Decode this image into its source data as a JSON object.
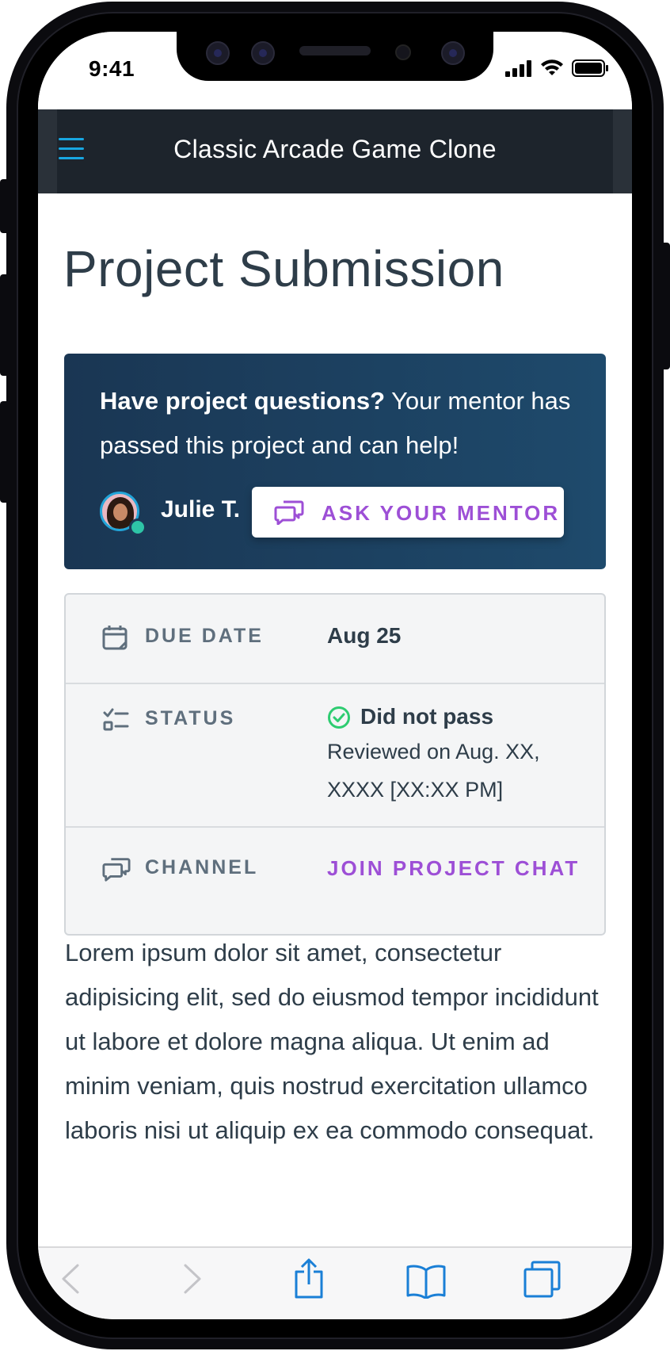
{
  "status_bar": {
    "time": "9:41"
  },
  "nav": {
    "title": "Classic Arcade Game Clone"
  },
  "page": {
    "title": "Project Submission"
  },
  "mentor_card": {
    "question_bold": "Have project questions?",
    "question_rest": " Your mentor has passed this project and can help!",
    "mentor_name": "Julie T.",
    "ask_button": "ASK YOUR MENTOR"
  },
  "info": {
    "due_date_label": "DUE DATE",
    "due_date_value": "Aug 25",
    "status_label": "STATUS",
    "status_value": "Did not pass",
    "reviewed_text": "Reviewed on Aug. XX, XXXX [XX:XX PM]",
    "channel_label": "CHANNEL",
    "channel_link": "JOIN PROJECT CHAT"
  },
  "body": {
    "text": "Lorem ipsum dolor sit amet, consectetur adipisicing elit, sed do eiusmod tempor incididunt ut labore et dolore magna aliqua. Ut enim ad minim veniam, quis nostrud exercitation ullamco laboris nisi ut aliquip ex ea commodo consequat."
  },
  "colors": {
    "accent_purple": "#9d4fd6",
    "nav_bg": "#1d242c",
    "menu_blue": "#18a6e0",
    "card_bg": "#1e4a6c",
    "status_green": "#2ecc71"
  },
  "icons": {
    "menu": "hamburger-icon",
    "chat": "chat-bubbles-icon",
    "calendar": "calendar-icon",
    "status": "checklist-icon",
    "check": "check-circle-icon",
    "back": "back-arrow-icon",
    "forward": "forward-arrow-icon",
    "share": "share-icon",
    "bookmarks": "bookmarks-icon",
    "tabs": "tabs-icon"
  }
}
